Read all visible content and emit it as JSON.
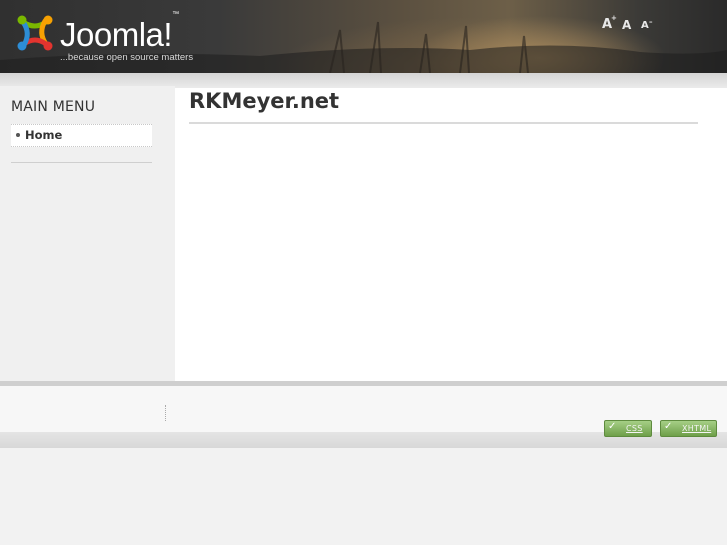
{
  "header": {
    "logo_text": "Joomla!",
    "logo_tm": "™",
    "tagline": "...because open source matters",
    "font_tools": {
      "increase": "A",
      "increase_sym": "+",
      "reset": "A",
      "decrease": "A",
      "decrease_sym": "–"
    }
  },
  "sidebar": {
    "title": "MAIN MENU",
    "items": [
      {
        "label": "Home"
      }
    ]
  },
  "main": {
    "title": "RKMeyer.net"
  },
  "footer": {
    "badges": [
      {
        "label": "CSS"
      },
      {
        "label": "XHTML"
      }
    ]
  }
}
